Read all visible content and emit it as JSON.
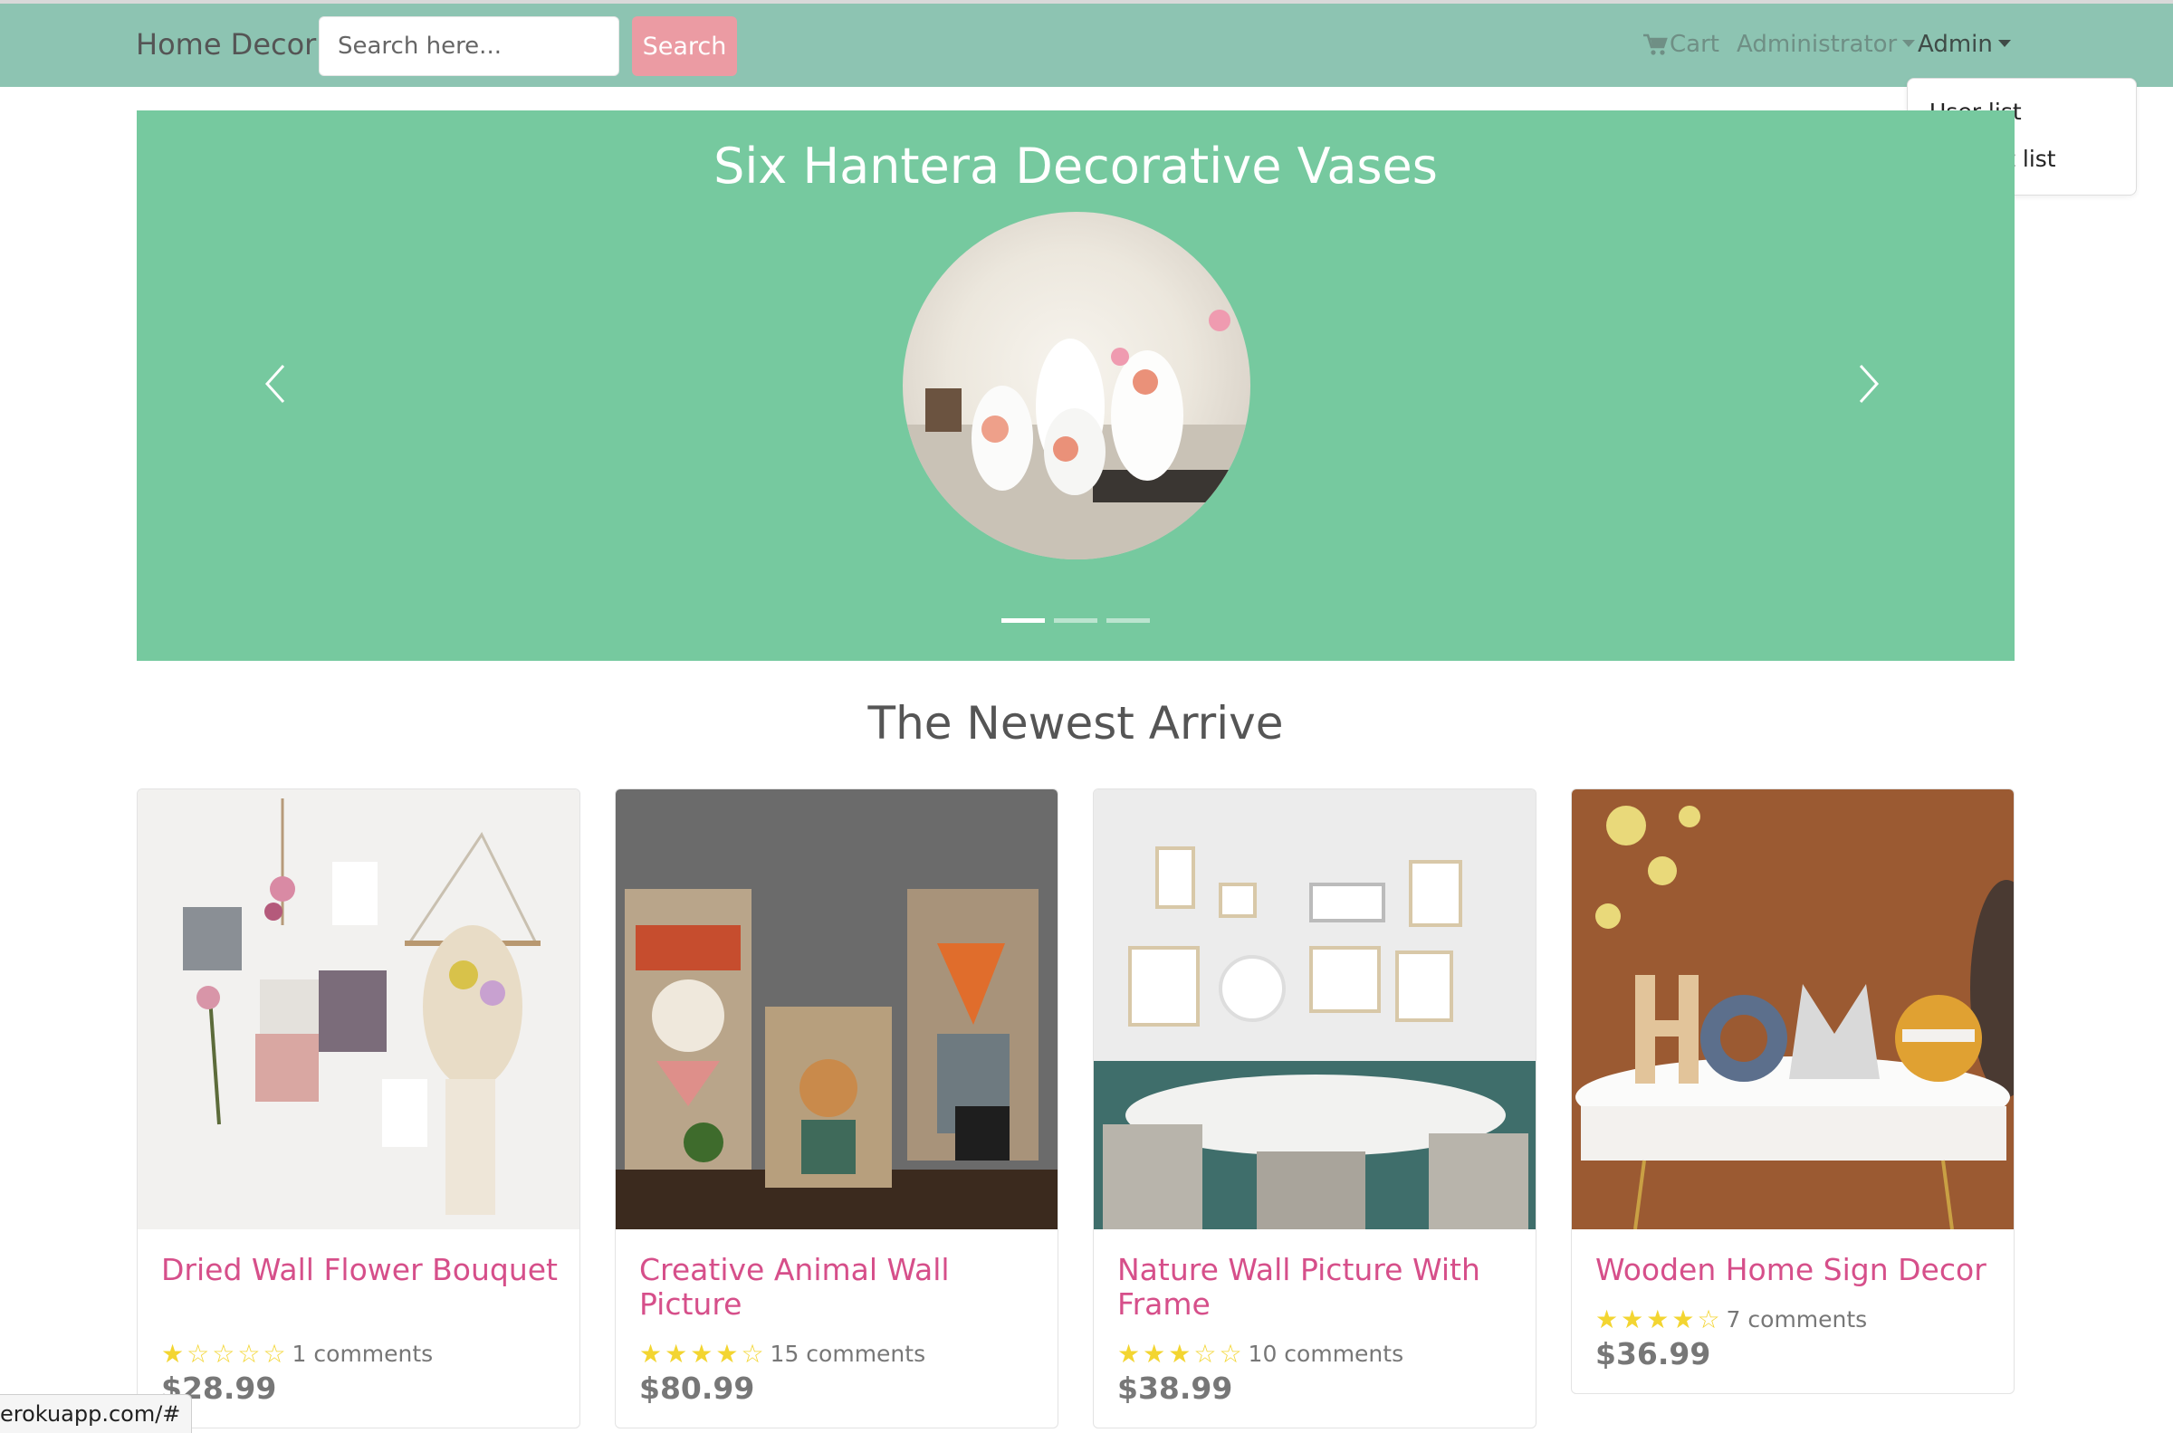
{
  "navbar": {
    "brand": "Home Decor",
    "search_placeholder": "Search here...",
    "search_button": "Search",
    "cart_label": "Cart",
    "admin_menu_label": "Administrator",
    "user_menu_label": "Admin"
  },
  "dropdown": {
    "items": [
      {
        "label": "User list"
      },
      {
        "label": "Product list"
      }
    ]
  },
  "carousel": {
    "title": "Six Hantera Decorative Vases",
    "slide_count": 3,
    "active_slide": 1
  },
  "section": {
    "title": "The Newest Arrive"
  },
  "products": [
    {
      "name": "Dried Wall Flower Bouquet",
      "rating": 1,
      "max_rating": 5,
      "comments": "1 comments",
      "price": "$28.99"
    },
    {
      "name": "Creative Animal Wall Picture",
      "rating": 4,
      "max_rating": 5,
      "comments": "15 comments",
      "price": "$80.99"
    },
    {
      "name": "Nature Wall Picture With Frame",
      "rating": 3,
      "max_rating": 5,
      "comments": "10 comments",
      "price": "$38.99"
    },
    {
      "name": "Wooden Home Sign Decor",
      "rating": 4,
      "max_rating": 5,
      "comments": "7 comments",
      "price": "$36.99"
    }
  ],
  "status_bar": {
    "url": "erokuapp.com/#"
  },
  "colors": {
    "navbar_bg": "#8dc4b2",
    "carousel_bg": "#76c99f",
    "search_button_bg": "#eb9ba3",
    "product_title": "#d64f8a",
    "star": "#f3d531"
  }
}
